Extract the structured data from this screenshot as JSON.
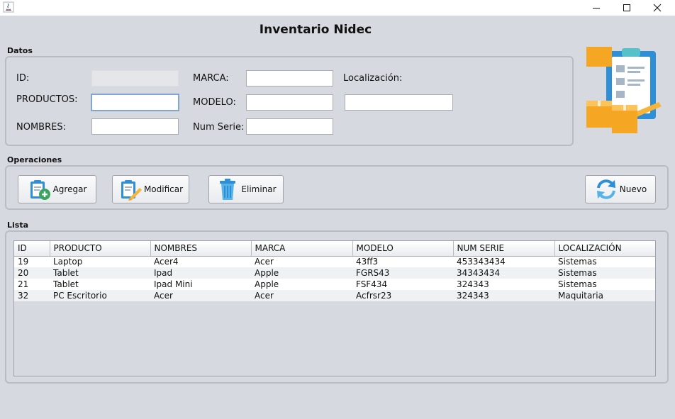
{
  "window": {
    "title": "",
    "controls": [
      "minimize-icon",
      "maximize-icon",
      "close-icon"
    ]
  },
  "app_title": "Inventario Nidec",
  "datos": {
    "section_label": "Datos",
    "id_label": "ID:",
    "id_value": "",
    "productos_label": "PRODUCTOS:",
    "productos_value": "",
    "nombres_label": "NOMBRES:",
    "nombres_value": "",
    "marca_label": "MARCA:",
    "marca_value": "",
    "modelo_label": "MODELO:",
    "modelo_value": "",
    "num_serie_label": "Num Serie:",
    "num_serie_value": "",
    "localizacion_label": "Localización:",
    "localizacion_value": ""
  },
  "operaciones": {
    "section_label": "Operaciones",
    "agregar": "Agregar",
    "modificar": "Modificar",
    "eliminar": "Eliminar",
    "nuevo": "Nuevo"
  },
  "lista": {
    "section_label": "Lista",
    "columns": [
      "ID",
      "PRODUCTO",
      "NOMBRES",
      "MARCA",
      "MODELO",
      "NUM SERIE",
      "LOCALIZACIÓN"
    ],
    "rows": [
      [
        "19",
        "Laptop",
        "Acer4",
        "Acer",
        "43ff3",
        "453343434",
        "Sistemas"
      ],
      [
        "20",
        "Tablet",
        "Ipad",
        "Apple",
        "FGRS43",
        "34343434",
        "Sistemas"
      ],
      [
        "21",
        "Tablet",
        "Ipad Mini",
        "Apple",
        "FSF434",
        "324343",
        "Sistemas"
      ],
      [
        "32",
        "PC Escritorio",
        "Acer",
        "Acer",
        "Acfrsr23",
        "324343",
        "Maquitaria"
      ]
    ]
  },
  "colors": {
    "background": "#d6d9df",
    "clipboard": "#2f8fd6",
    "box": "#f5a623",
    "pencil": "#f7b43a",
    "add_badge": "#3aa55d",
    "refresh": "#2f8fd6"
  },
  "icons": {
    "logo": "clipboard-boxes-icon",
    "agregar": "clipboard-add-icon",
    "modificar": "clipboard-edit-icon",
    "eliminar": "trash-icon",
    "nuevo": "refresh-icon"
  }
}
